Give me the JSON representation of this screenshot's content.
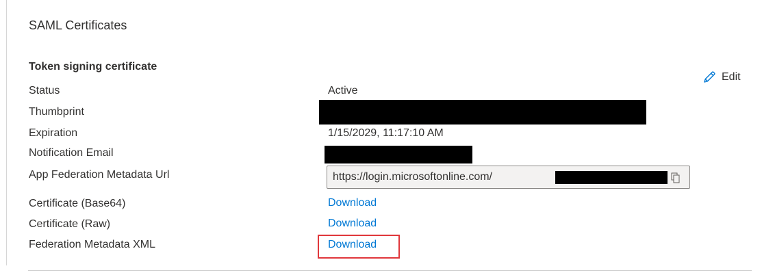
{
  "section": {
    "title": "SAML Certificates"
  },
  "token_signing": {
    "heading": "Token signing certificate",
    "edit_label": "Edit",
    "edit_icon": "pencil-icon",
    "rows": [
      {
        "label": "Status",
        "value": "Active"
      },
      {
        "label": "Thumbprint",
        "value": ""
      },
      {
        "label": "Expiration",
        "value": "1/15/2029, 11:17:10 AM"
      },
      {
        "label": "Notification Email",
        "value": ""
      },
      {
        "label": "App Federation Metadata Url",
        "value": "https://login.microsoftonline.com/"
      },
      {
        "label": "Certificate (Base64)",
        "link": "Download"
      },
      {
        "label": "Certificate (Raw)",
        "link": "Download"
      },
      {
        "label": "Federation Metadata XML",
        "link": "Download"
      }
    ],
    "copy_icon": "copy-icon"
  },
  "colors": {
    "link": "#0078d4",
    "highlight": "#e0373b",
    "redaction": "#000000",
    "icon": "#0078d4"
  }
}
